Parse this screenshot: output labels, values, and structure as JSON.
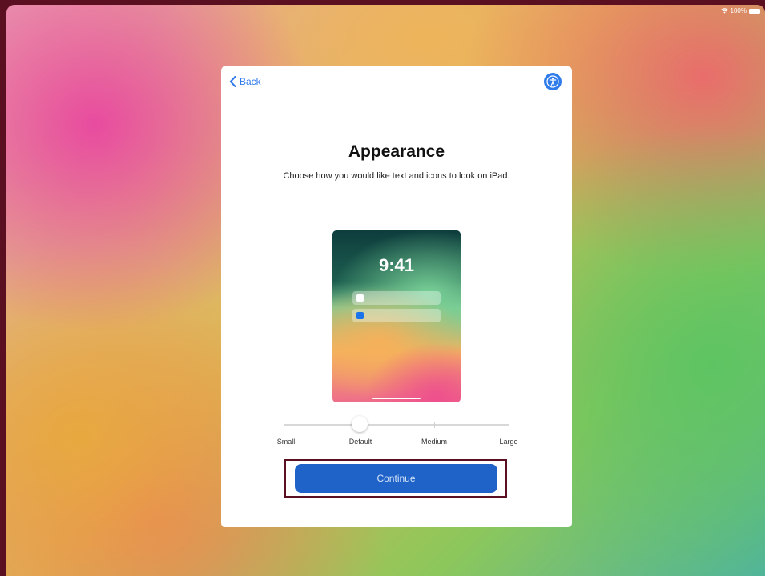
{
  "status_bar": {
    "battery_text": "100%"
  },
  "nav": {
    "back_label": "Back"
  },
  "page": {
    "title": "Appearance",
    "subtitle": "Choose how you would like text and icons to look on iPad."
  },
  "preview": {
    "time": "9:41"
  },
  "size_slider": {
    "options": [
      "Small",
      "Default",
      "Medium",
      "Large"
    ],
    "selected": "Default"
  },
  "actions": {
    "continue_label": "Continue"
  },
  "colors": {
    "accent": "#2f7bea",
    "button": "#1f63c8",
    "highlight_border": "#5a1020"
  }
}
